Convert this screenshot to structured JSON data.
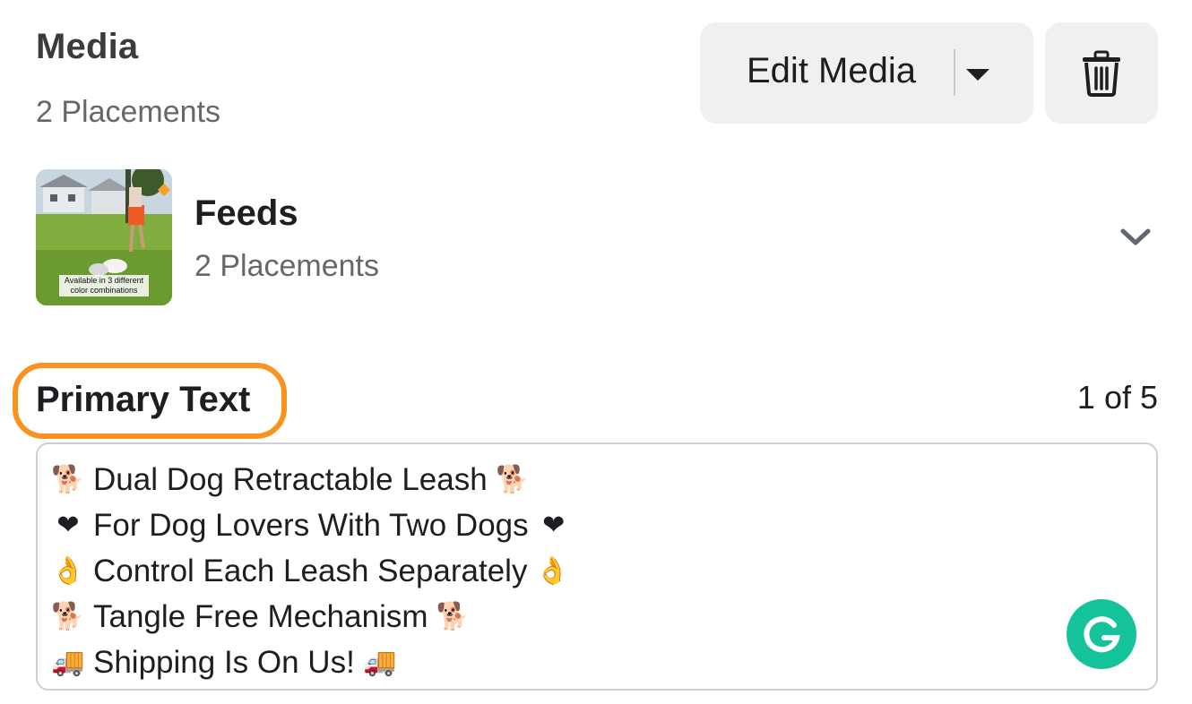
{
  "header": {
    "title": "Media",
    "placements": "2 Placements",
    "edit_media_label": "Edit Media"
  },
  "feeds": {
    "title": "Feeds",
    "placements": "2 Placements",
    "thumbnail_caption": "Available in 3 different color combinations"
  },
  "primary_text": {
    "label": "Primary Text",
    "counter": "1 of 5",
    "lines": [
      {
        "icon": "dog-icon",
        "emoji": "🐕",
        "text": "Dual Dog Retractable Leash"
      },
      {
        "icon": "heart-icon",
        "emoji": "❤",
        "text": "For Dog Lovers With Two Dogs"
      },
      {
        "icon": "ok-hand-icon",
        "emoji": "👌",
        "text": "Control Each Leash Separately"
      },
      {
        "icon": "service-dog-icon",
        "emoji": "🐕",
        "text": "Tangle Free Mechanism"
      },
      {
        "icon": "delivery-truck-icon",
        "emoji": "🚚",
        "text": "Shipping Is On Us!"
      }
    ]
  },
  "colors": {
    "highlight_ring": "#f7931e",
    "button_bg": "#f0f0f0",
    "grammarly_green": "#15c39a",
    "muted_text": "#65676b"
  }
}
